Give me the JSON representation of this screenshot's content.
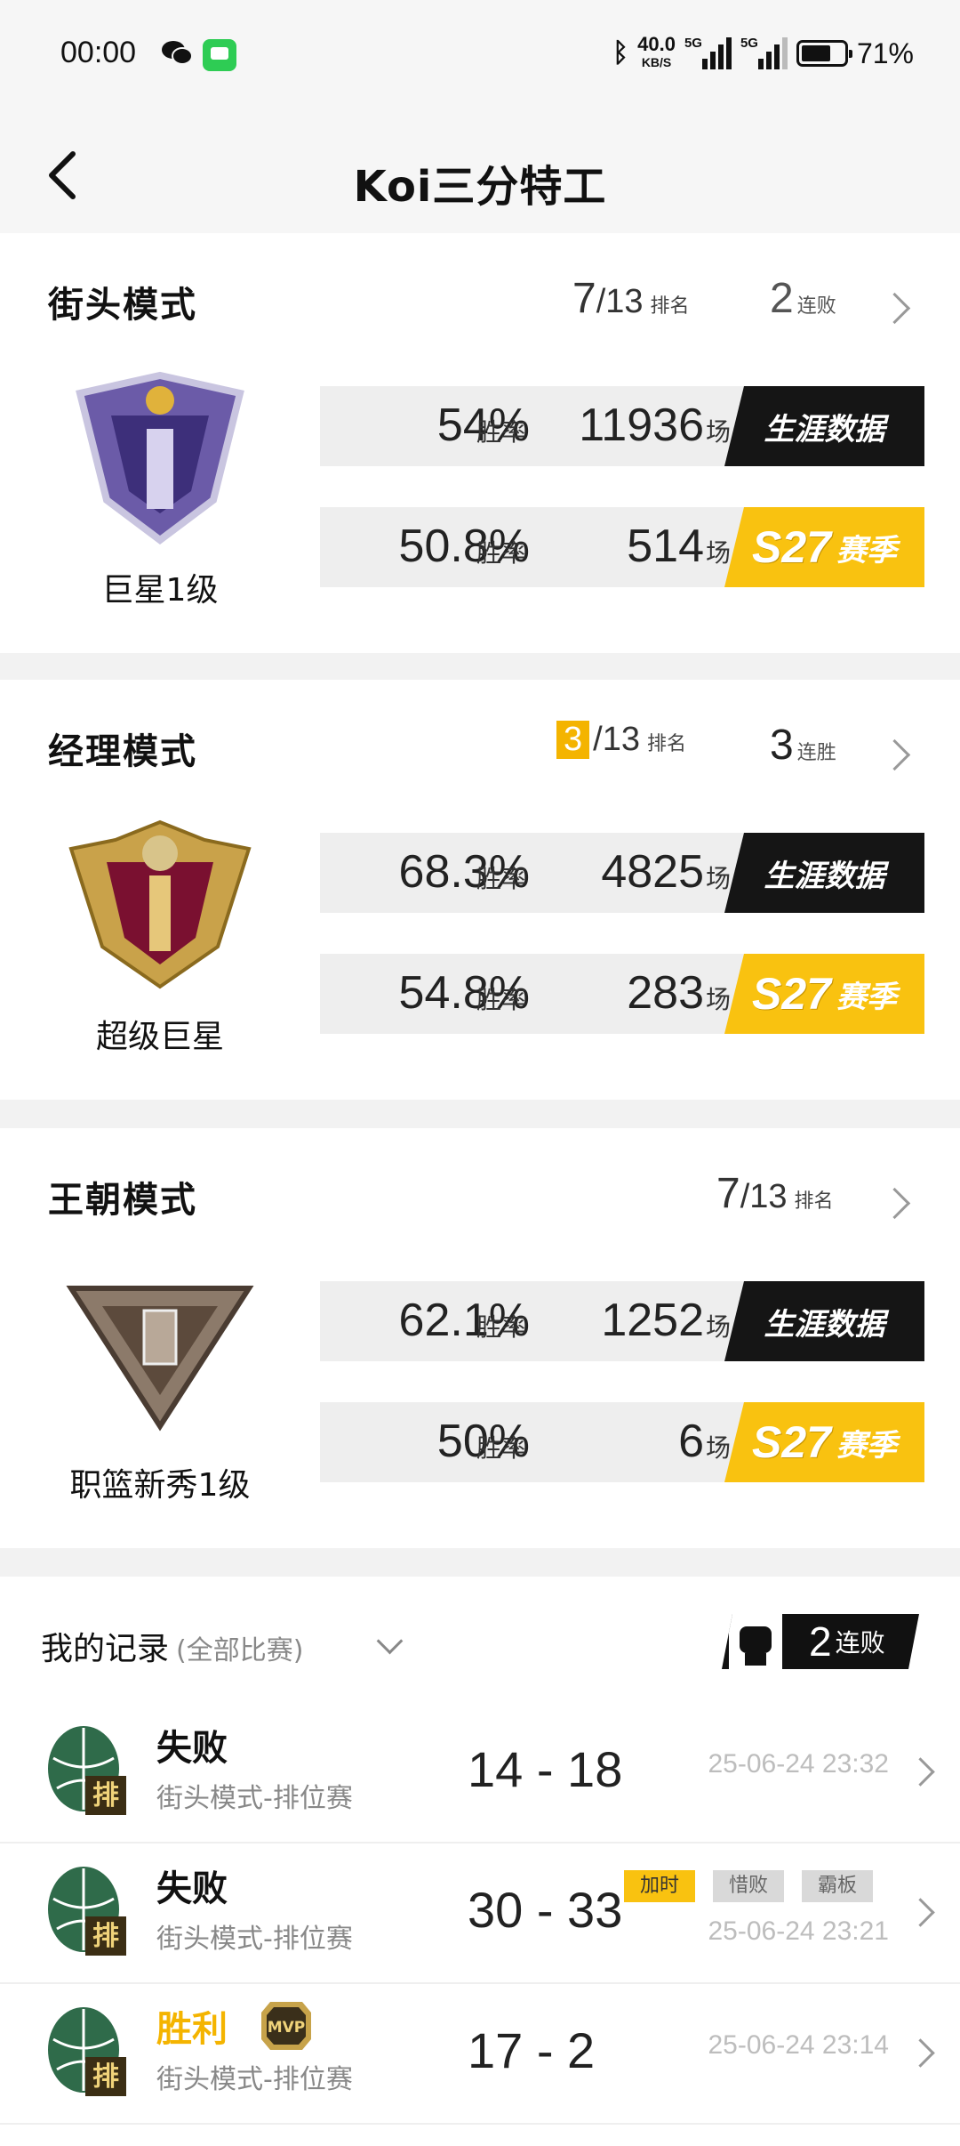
{
  "status_bar": {
    "time": "00:00",
    "speed_value": "40.0",
    "speed_unit": "KB/S",
    "network_1": "5G",
    "network_2": "5G",
    "battery_pct": "71%"
  },
  "header": {
    "title": "Koi三分特工"
  },
  "modes": [
    {
      "name": "街头模式",
      "rank_pos": "7",
      "rank_total": "/13",
      "rank_label": "排名",
      "streak_count": "2",
      "streak_label": "连败",
      "tier": "巨星1级",
      "career": {
        "win_rate": "54%",
        "rate_label": "胜率",
        "games": "11936",
        "games_label": "场",
        "button": "生涯数据"
      },
      "season": {
        "win_rate": "50.8%",
        "rate_label": "胜率",
        "games": "514",
        "games_label": "场",
        "season_code": "S27",
        "season_word": "赛季"
      }
    },
    {
      "name": "经理模式",
      "rank_pos": "3",
      "rank_total": "/13",
      "rank_label": "排名",
      "streak_count": "3",
      "streak_label": "连胜",
      "tier": "超级巨星",
      "career": {
        "win_rate": "68.3%",
        "rate_label": "胜率",
        "games": "4825",
        "games_label": "场",
        "button": "生涯数据"
      },
      "season": {
        "win_rate": "54.8%",
        "rate_label": "胜率",
        "games": "283",
        "games_label": "场",
        "season_code": "S27",
        "season_word": "赛季"
      }
    },
    {
      "name": "王朝模式",
      "rank_pos": "7",
      "rank_total": "/13",
      "rank_label": "排名",
      "tier": "职篮新秀1级",
      "career": {
        "win_rate": "62.1%",
        "rate_label": "胜率",
        "games": "1252",
        "games_label": "场",
        "button": "生涯数据"
      },
      "season": {
        "win_rate": "50%",
        "rate_label": "胜率",
        "games": "6",
        "games_label": "场",
        "season_code": "S27",
        "season_word": "赛季"
      }
    }
  ],
  "records": {
    "title": "我的记录",
    "filter": "(全部比赛)",
    "streak_count": "2",
    "streak_label": "连败",
    "icon_badge": "排",
    "matches": [
      {
        "result": "失败",
        "mode": "街头模式-排位赛",
        "score": "14 - 18",
        "time": "25-06-24 23:32"
      },
      {
        "result": "失败",
        "mode": "街头模式-排位赛",
        "score": "30 - 33",
        "time": "25-06-24 23:21",
        "tags": [
          "加时",
          "惜败",
          "霸板"
        ]
      },
      {
        "result": "胜利",
        "mode": "街头模式-排位赛",
        "score": "17 - 2",
        "time": "25-06-24 23:14",
        "mvp": "MVP"
      }
    ]
  },
  "colors": {
    "accent_gold": "#f9c210",
    "dark": "#151515",
    "win": "#f4b400"
  }
}
